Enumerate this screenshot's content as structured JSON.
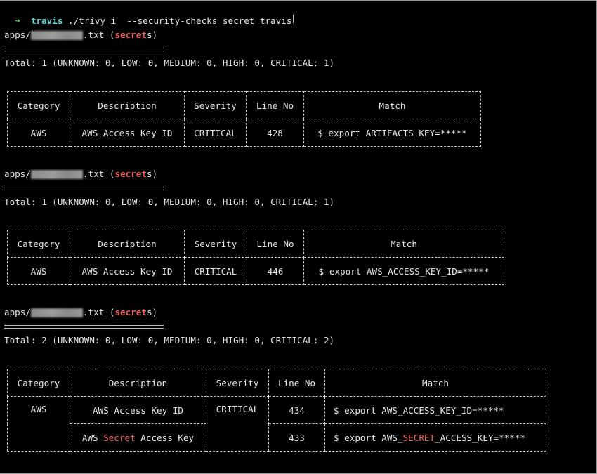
{
  "terminal": {
    "prompt": {
      "arrow": "➜",
      "cwd": "travis",
      "command": " ./trivy i  --security-checks secret travis"
    },
    "results": [
      {
        "target_prefix": "apps/",
        "target_suffix": ".txt",
        "type_open": " (",
        "type_highlight": "secret",
        "type_rest": "s",
        "type_close": ")",
        "underline": "==============================",
        "total": "Total: 1 (UNKNOWN: 0, LOW: 0, MEDIUM: 0, HIGH: 0, CRITICAL: 1)",
        "table": {
          "headers": [
            "Category",
            "Description",
            "Severity",
            "Line No",
            "Match"
          ],
          "rows": [
            {
              "category": "AWS",
              "description": "AWS Access Key ID",
              "severity": "CRITICAL",
              "line_no": "428",
              "match": "$ export ARTIFACTS_KEY=*****"
            }
          ]
        }
      },
      {
        "target_prefix": "apps/",
        "target_suffix": ".txt",
        "type_open": " (",
        "type_highlight": "secret",
        "type_rest": "s",
        "type_close": ")",
        "underline": "==============================",
        "total": "Total: 1 (UNKNOWN: 0, LOW: 0, MEDIUM: 0, HIGH: 0, CRITICAL: 1)",
        "table": {
          "headers": [
            "Category",
            "Description",
            "Severity",
            "Line No",
            "Match"
          ],
          "rows": [
            {
              "category": "AWS",
              "description": "AWS Access Key ID",
              "severity": "CRITICAL",
              "line_no": "446",
              "match": "$ export AWS_ACCESS_KEY_ID=*****"
            }
          ]
        }
      },
      {
        "target_prefix": "apps/",
        "target_suffix": ".txt",
        "type_open": " (",
        "type_highlight": "secret",
        "type_rest": "s",
        "type_close": ")",
        "underline": "==============================",
        "total": "Total: 2 (UNKNOWN: 0, LOW: 0, MEDIUM: 0, HIGH: 0, CRITICAL: 2)",
        "table": {
          "headers": [
            "Category",
            "Description",
            "Severity",
            "Line No",
            "Match"
          ],
          "rows": [
            {
              "category": "AWS",
              "description": "AWS Access Key ID",
              "severity": "CRITICAL",
              "line_no": "434",
              "match": "$ export AWS_ACCESS_KEY_ID=*****"
            },
            {
              "description_pre": "AWS ",
              "description_highlight": "Secret",
              "description_post": " Access Key",
              "line_no": "433",
              "match_pre": "$ export AWS_",
              "match_highlight": "SECRET",
              "match_post": "_ACCESS_KEY=*****"
            }
          ]
        }
      }
    ]
  },
  "colors": {
    "background": "#000000",
    "text": "#e6e6e6",
    "prompt_arrow": "#5fd75f",
    "prompt_dir": "#5fd7d7",
    "highlight_red": "#f0605a"
  }
}
